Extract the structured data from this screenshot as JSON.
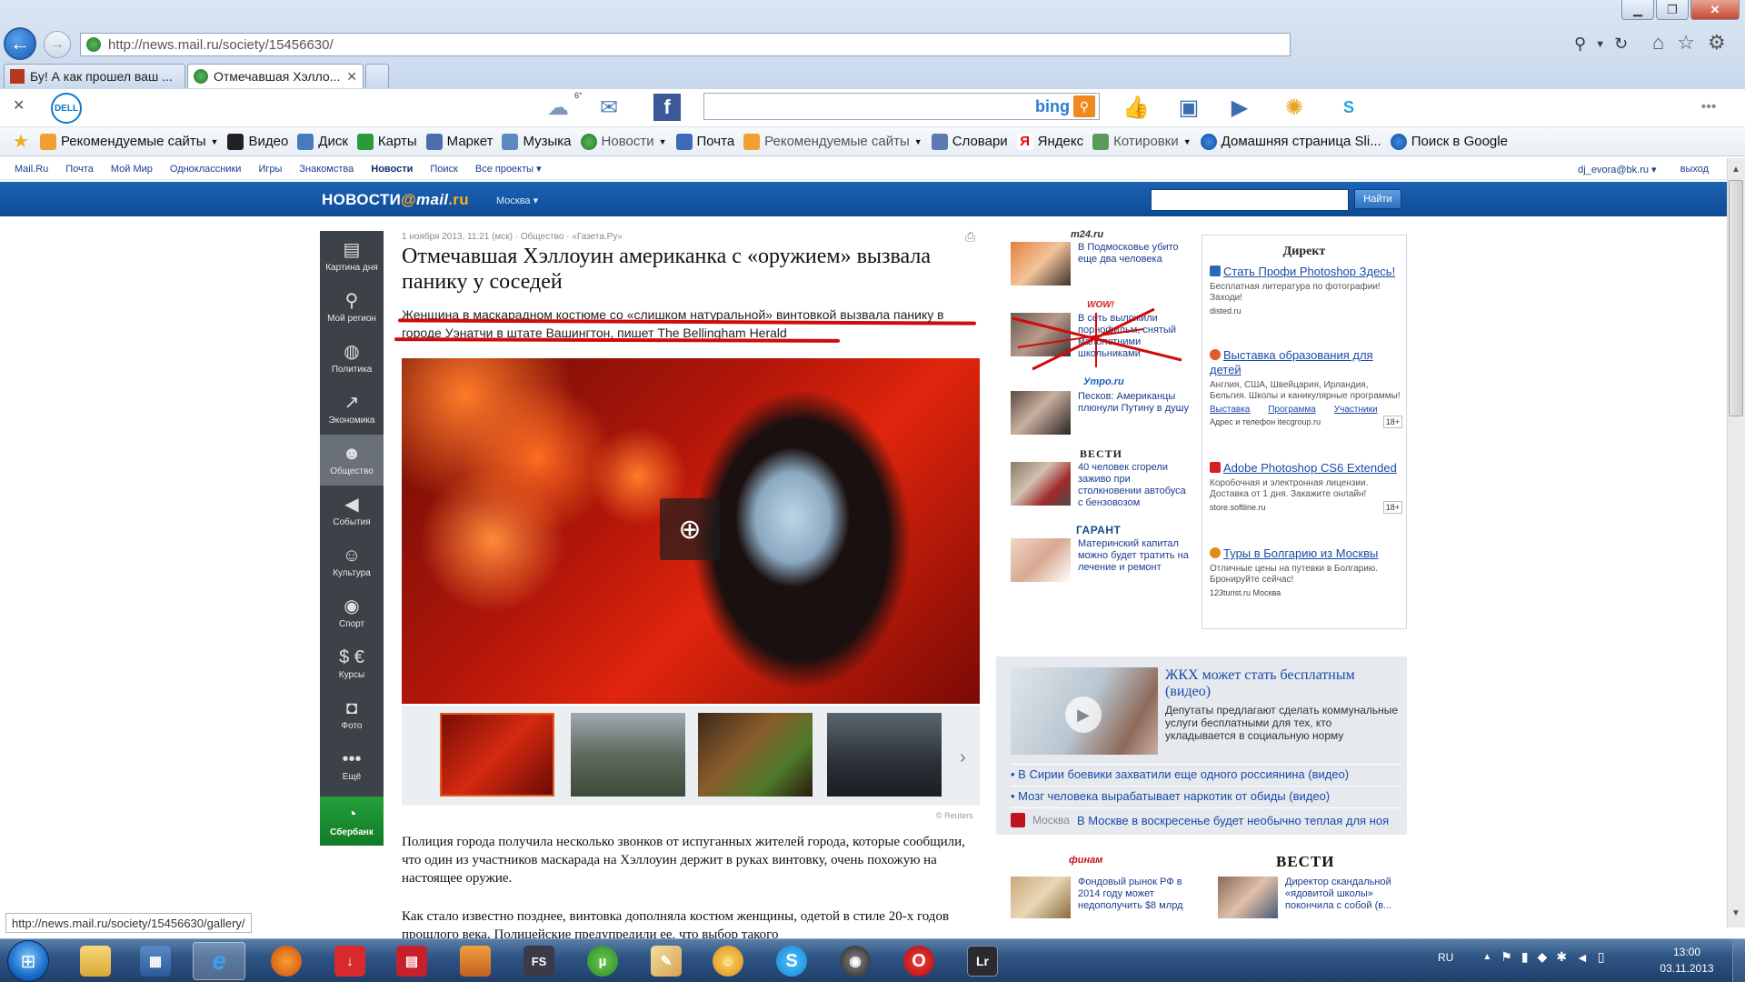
{
  "browser": {
    "url": "http://news.mail.ru/society/15456630/",
    "tabs": [
      {
        "label": "Бу! А как прошел ваш ..."
      },
      {
        "label": "Отмечавшая Хэлло..."
      }
    ],
    "toolbar": {
      "weather_temp": "6°",
      "search_brand": "bing"
    },
    "favorites": [
      {
        "label": "Рекомендуемые сайты",
        "has_menu": true
      },
      {
        "label": "Видео"
      },
      {
        "label": "Диск"
      },
      {
        "label": "Карты"
      },
      {
        "label": "Маркет"
      },
      {
        "label": "Музыка"
      },
      {
        "label": "Новости",
        "has_menu": true
      },
      {
        "label": "Почта"
      },
      {
        "label": "Рекомендуемые сайты",
        "has_menu": true
      },
      {
        "label": "Словари"
      },
      {
        "label": "Яндекс"
      },
      {
        "label": "Котировки",
        "has_menu": true
      },
      {
        "label": "Домашняя страница Sli..."
      },
      {
        "label": "Поиск в Google"
      }
    ],
    "status_url": "http://news.mail.ru/society/15456630/gallery/"
  },
  "mailnav": {
    "items": [
      "Mail.Ru",
      "Почта",
      "Мой Мир",
      "Одноклассники",
      "Игры",
      "Знакомства",
      "Новости",
      "Поиск",
      "Все проекты ▾"
    ],
    "user": "dj_evora@bk.ru ▾",
    "logout": "выход"
  },
  "header": {
    "logo_news": "НОВОСТИ",
    "logo_at": "@",
    "logo_mail": "mail",
    "logo_ru": ".ru",
    "city": "Москва ▾",
    "search_button": "Найти"
  },
  "leftnav": [
    {
      "label": "Картина дня",
      "icon": "newspaper-icon",
      "glyph": "▤"
    },
    {
      "label": "Мой регион",
      "icon": "map-pin-icon",
      "glyph": "⚲"
    },
    {
      "label": "Политика",
      "icon": "globe-icon",
      "glyph": "◍"
    },
    {
      "label": "Экономика",
      "icon": "chart-icon",
      "glyph": "↗"
    },
    {
      "label": "Общество",
      "icon": "people-icon",
      "glyph": "☻",
      "active": true
    },
    {
      "label": "События",
      "icon": "megaphone-icon",
      "glyph": "◀"
    },
    {
      "label": "Культура",
      "icon": "theatre-masks-icon",
      "glyph": "☺"
    },
    {
      "label": "Спорт",
      "icon": "soccer-ball-icon",
      "glyph": "◉"
    },
    {
      "label": "Курсы",
      "icon": "currency-icon",
      "glyph": "$ €"
    },
    {
      "label": "Фото",
      "icon": "camera-icon",
      "glyph": "◘"
    },
    {
      "label": "Ещё",
      "icon": "more-dots-icon",
      "glyph": "•••"
    }
  ],
  "sberbank": {
    "label": "Сбербанк"
  },
  "article": {
    "meta": "1 ноября 2013, 11:21 (мск) · Общество · «Газета.Ру»",
    "headline": "Отмечавшая Хэллоуин американка с «оружием» вызвала панику у соседей",
    "lead": "Женщина в маскарадном костюме со «слишком натуральной» винтовкой вызвала панику в городе Уэнатчи в штате Вашингтон, пишет The Bellingham Herald",
    "photo_credit": "© Reuters",
    "body1": "Полиция города получила несколько звонков от испуганных жителей города, которые сообщили, что один из участников маскарада на Хэллоуин держит в руках винтовку, очень похожую на настоящее оружие.",
    "body2": "Как стало известно позднее, винтовка дополняла костюм женщины, одетой в стиле 20-х годов прошлого века. Полицейские предупредили ее, что выбор такого"
  },
  "partner_news": [
    {
      "source": "m24.ru",
      "text": "В Подмосковье убито еще два человека"
    },
    {
      "source": "WOW!",
      "text": "В сеть выложили порнофильм, снятый малолетними школьниками"
    },
    {
      "source": "Утро.ru",
      "text": "Песков: Американцы плюнули Путину в душу"
    },
    {
      "source": "ВЕСТИ",
      "text": "40 человек сгорели заживо при столкновении автобуса с бензовозом"
    },
    {
      "source": "ГАРАНТ",
      "text": "Материнский капитал можно будет тратить на лечение и ремонт"
    }
  ],
  "direct": {
    "title": "Директ",
    "ads": [
      {
        "title": "Стать Профи Photoshop Здесь!",
        "text": "Бесплатная литература по фотографии! Заходи!",
        "domain": "disted.ru"
      },
      {
        "title": "Выставка образования для детей",
        "text": "Англия, США, Швейцария, Ирландия, Бельгия. Школы и каникулярные программы!",
        "links": [
          "Выставка",
          "Программа",
          "Участники"
        ],
        "domain": "Адрес и телефон  itecgroup.ru",
        "age": "18+"
      },
      {
        "title": "Adobe Photoshop CS6 Extended",
        "text": "Коробочная и электронная лицензии. Доставка от 1 дня. Закажите онлайн!",
        "domain": "store.softline.ru",
        "age": "18+"
      },
      {
        "title": "Туры в Болгарию из Москвы",
        "text": "Отличные цены на путевки в Болгарию. Бронируйте сейчас!",
        "domain": "123turist.ru  Москва"
      }
    ]
  },
  "video": {
    "title": "ЖКХ может стать бесплатным (видео)",
    "text": "Депутаты предлагают сделать коммунальные услуги бесплатными для тех, кто укладывается в социальную норму",
    "links": [
      "В Сирии боевики захватили еще одного россиянина (видео)",
      "Мозг человека вырабатывает наркотик от обиды (видео)"
    ],
    "moscow_place": "Москва",
    "moscow_text": "В Москве в воскресенье будет необычно теплая для ноя"
  },
  "bottom": {
    "finam_logo": "финам",
    "vesti_logo": "ВЕСТИ",
    "items": [
      {
        "text": "Фондовый рынок РФ в 2014 году может недополучить $8 млрд"
      },
      {
        "text": "Директор скандальной «ядовитой школы» покончила с собой (в..."
      }
    ]
  },
  "taskbar": {
    "lang": "RU",
    "time": "13:00",
    "date": "03.11.2013"
  }
}
